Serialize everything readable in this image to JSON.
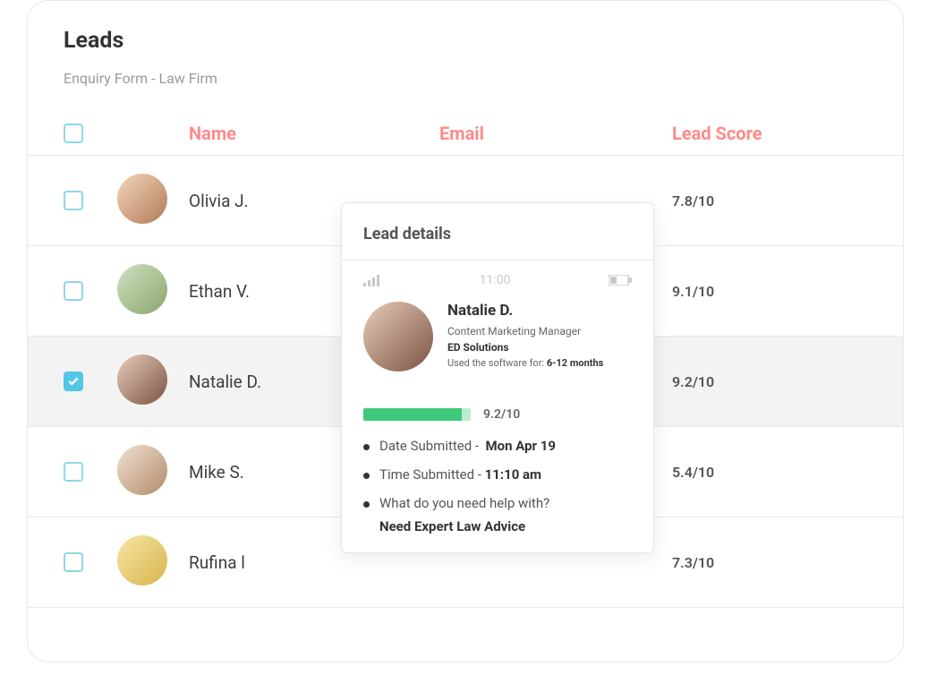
{
  "page": {
    "title": "Leads",
    "subtitle": "Enquiry Form - Law Firm"
  },
  "table": {
    "headers": {
      "name": "Name",
      "email": "Email",
      "score": "Lead Score"
    },
    "rows": [
      {
        "name": "Olivia J.",
        "score": "7.8/10",
        "selected": false,
        "avatar_bg": "linear-gradient(135deg,#f6d6b9,#b07a5a)"
      },
      {
        "name": "Ethan V.",
        "score": "9.1/10",
        "selected": false,
        "avatar_bg": "linear-gradient(135deg,#cfe2c2,#8aa56e)"
      },
      {
        "name": "Natalie D.",
        "score": "9.2/10",
        "selected": true,
        "avatar_bg": "linear-gradient(135deg,#e7cdbb,#7a5340)"
      },
      {
        "name": "Mike S.",
        "score": "5.4/10",
        "selected": false,
        "avatar_bg": "linear-gradient(135deg,#f0e0d0,#b38b6a)"
      },
      {
        "name": "Rufina l",
        "score": "7.3/10",
        "selected": false,
        "avatar_bg": "linear-gradient(135deg,#f8e6a6,#d7b34a)"
      }
    ]
  },
  "panel": {
    "title": "Lead details",
    "status_time": "11:00",
    "lead": {
      "name": "Natalie D.",
      "role": "Content Marketing Manager",
      "company": "ED Solutions",
      "used_label": "Used the software for:",
      "used_value": "6-12 months",
      "avatar_bg": "linear-gradient(135deg,#e7cdbb,#7a5340)"
    },
    "score": "9.2/10",
    "details": {
      "date_label": "Date Submitted -",
      "date_value": "Mon Apr 19",
      "time_label": "Time Submitted -",
      "time_value": "11:10 am",
      "question": "What do you need help with?",
      "answer": "Need Expert Law Advice"
    }
  }
}
